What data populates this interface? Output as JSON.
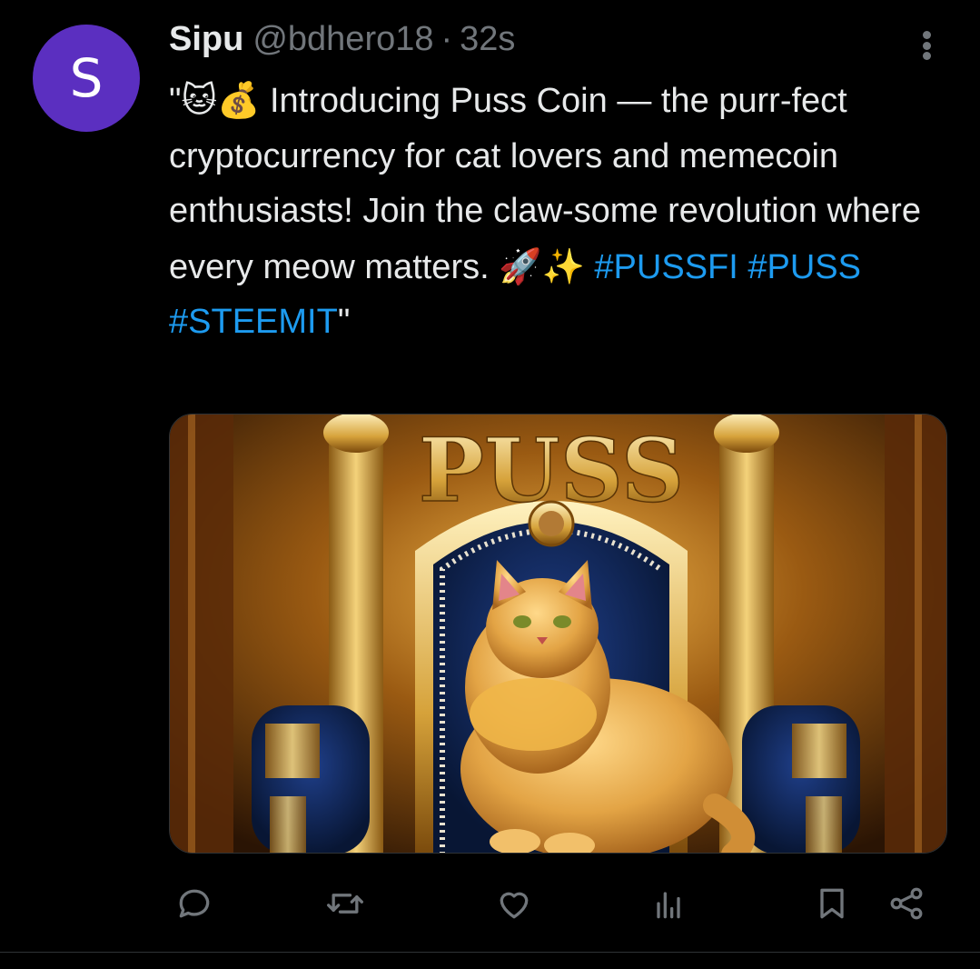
{
  "tweet": {
    "avatar_letter": "S",
    "author_name": "Sipu",
    "author_handle": "@bdhero18",
    "separator": "·",
    "time": "32s",
    "text_parts": {
      "p1": "\"",
      "emoji1": "🐱💰",
      "p2": " Introducing Puss Coin — the purr-fect cryptocurrency for cat lovers and memecoin enthusiasts! Join the claw-some revolution where every meow matters. ",
      "emoji2": "🚀✨",
      "p3": " ",
      "tag1": "#PUSSFI",
      "p4": " ",
      "tag2": "#PUSS",
      "p5": " ",
      "tag3": "#STEEMIT",
      "p6": "\""
    },
    "media": {
      "title_text": "PUSS",
      "description": "golden cat on royal throne"
    }
  },
  "actions": {
    "reply_icon": "reply-icon",
    "retweet_icon": "retweet-icon",
    "like_icon": "heart-icon",
    "views_icon": "analytics-icon",
    "bookmark_icon": "bookmark-icon",
    "share_icon": "share-icon"
  },
  "colors": {
    "background": "#000000",
    "text": "#e7e9ea",
    "secondary": "#71767b",
    "link": "#1d9bf0",
    "avatar": "#5b2fc0"
  }
}
